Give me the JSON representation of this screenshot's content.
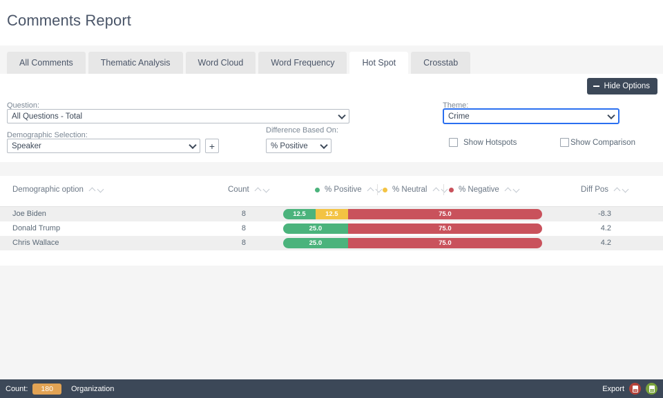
{
  "page_title": "Comments Report",
  "tabs": [
    {
      "label": "All Comments",
      "active": false
    },
    {
      "label": "Thematic Analysis",
      "active": false
    },
    {
      "label": "Word Cloud",
      "active": false
    },
    {
      "label": "Word Frequency",
      "active": false
    },
    {
      "label": "Hot Spot",
      "active": true
    },
    {
      "label": "Crosstab",
      "active": false
    }
  ],
  "options": {
    "hide_options_label": "Hide Options",
    "question_label": "Question:",
    "question_value": "All Questions - Total",
    "demographic_label": "Demographic Selection:",
    "demographic_value": "Speaker",
    "add_demographic_label": "+",
    "difference_label": "Difference Based On:",
    "difference_value": "% Positive",
    "theme_label": "Theme:",
    "theme_value": "Crime",
    "show_hotspots_label": "Show Hotspots",
    "show_comparison_label": "Show Comparison"
  },
  "table": {
    "columns": {
      "demographic": "Demographic option",
      "count": "Count",
      "positive": "% Positive",
      "neutral": "% Neutral",
      "negative": "% Negative",
      "diff_pos": "Diff Pos"
    },
    "rows": [
      {
        "name": "Joe Biden",
        "count": "8",
        "positive": "12.5",
        "neutral": "12.5",
        "negative": "75.0",
        "diff_pos": "-8.3"
      },
      {
        "name": "Donald Trump",
        "count": "8",
        "positive": "25.0",
        "neutral": "",
        "negative": "75.0",
        "diff_pos": "4.2"
      },
      {
        "name": "Chris Wallace",
        "count": "8",
        "positive": "25.0",
        "neutral": "",
        "negative": "75.0",
        "diff_pos": "4.2"
      }
    ]
  },
  "footer": {
    "count_label": "Count:",
    "count_value": "180",
    "organization_label": "Organization",
    "export_label": "Export",
    "export_pdf_icon": "pdf-export-icon",
    "export_xls_icon": "xls-export-icon"
  },
  "colors": {
    "positive": "#4bb37c",
    "neutral": "#f3c343",
    "negative": "#c9525c",
    "accent_dark": "#3c4858",
    "badge": "#e2a354",
    "focus": "#2a6ff0"
  },
  "chart_data": {
    "type": "bar",
    "title": "Hot Spot sentiment distribution by Speaker (Theme: Crime)",
    "categories": [
      "Joe Biden",
      "Donald Trump",
      "Chris Wallace"
    ],
    "series": [
      {
        "name": "% Positive",
        "values": [
          12.5,
          25.0,
          25.0
        ],
        "color": "#4bb37c"
      },
      {
        "name": "% Neutral",
        "values": [
          12.5,
          0,
          0
        ],
        "color": "#f3c343"
      },
      {
        "name": "% Negative",
        "values": [
          75.0,
          75.0,
          75.0
        ],
        "color": "#c9525c"
      }
    ],
    "extra_columns": {
      "Count": [
        8,
        8,
        8
      ],
      "Diff Pos": [
        -8.3,
        4.2,
        4.2
      ]
    },
    "xlabel": "",
    "ylabel": "",
    "xlim": [
      0,
      100
    ],
    "grid": false,
    "legend": "top",
    "stacked": true
  }
}
